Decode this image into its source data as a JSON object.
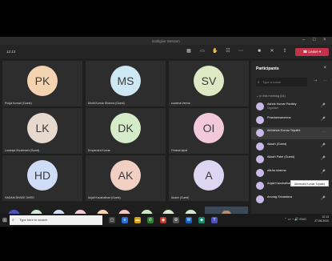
{
  "window": {
    "title": "Earligive Session"
  },
  "toolbar": {
    "time": "12:13",
    "leave_label": "Leave"
  },
  "tiles": [
    {
      "initials": "PK",
      "name": "Pooja Kumari (Guest)",
      "color": "#f3d3b0"
    },
    {
      "initials": "MS",
      "name": "Mohit Kumar Sharma (Guest)",
      "color": "#cde7f3"
    },
    {
      "initials": "SV",
      "name": "suvarna Verma",
      "color": "#dfe8c4"
    },
    {
      "initials": "LK",
      "name": "Lovanya Khushwah (Guest)",
      "color": "#e8d9cf"
    },
    {
      "initials": "DK",
      "name": "Dropendra Kumar",
      "color": "#d5ecc9"
    },
    {
      "initials": "OI",
      "name": "Omana Iqbal",
      "color": "#f2c9d9"
    },
    {
      "initials": "HD",
      "name": "HADAM BHAKE DHRO",
      "color": "#cfdcf5"
    },
    {
      "initials": "AK",
      "name": "Anjali Kaushalhan (Guest)",
      "color": "#f1cfc3"
    },
    {
      "initials": "A",
      "name": "Akash (Guest)",
      "color": "#dcd6f3"
    }
  ],
  "strip": {
    "more": "+26",
    "avatars": [
      {
        "initials": "NG",
        "color": "#cde8cf"
      },
      {
        "initials": "AT",
        "color": "#d3dcf5"
      },
      {
        "initials": "Ta",
        "color": "#f2c9d9"
      },
      {
        "initials": "RN",
        "color": "#f3d3b0"
      },
      {
        "initials": "P",
        "color": "#f1c8c0"
      },
      {
        "initials": "S",
        "color": "#cfe6c8"
      },
      {
        "initials": "SS",
        "color": "#d9e8cc"
      },
      {
        "initials": "SB",
        "color": "#cfe6c8"
      }
    ]
  },
  "panel": {
    "title": "Participants",
    "search_placeholder": "Type a name",
    "section_label": "In this meeting (44)",
    "participants": [
      {
        "name": "Ashok Kumar Pantley",
        "role": "Organiser",
        "highlight": false
      },
      {
        "name": "Prashamsaveena",
        "role": "",
        "highlight": false
      },
      {
        "name": "Abhishek Kumar Tripathi",
        "role": "",
        "highlight": true
      },
      {
        "name": "Akash (Guest)",
        "role": "",
        "highlight": false
      },
      {
        "name": "Akash Patel (Guest)",
        "role": "",
        "highlight": false
      },
      {
        "name": "alisha sharma",
        "role": "",
        "highlight": false
      },
      {
        "name": "Anjali Kaushalhan (Guest)",
        "role": "",
        "highlight": false
      },
      {
        "name": "Anurag Srivastava",
        "role": "",
        "highlight": false
      }
    ],
    "tooltip": "Abhishek Kumar Tripathi"
  },
  "taskbar": {
    "search_placeholder": "Type here to search",
    "time": "12:13",
    "date": "27-08-2020"
  }
}
